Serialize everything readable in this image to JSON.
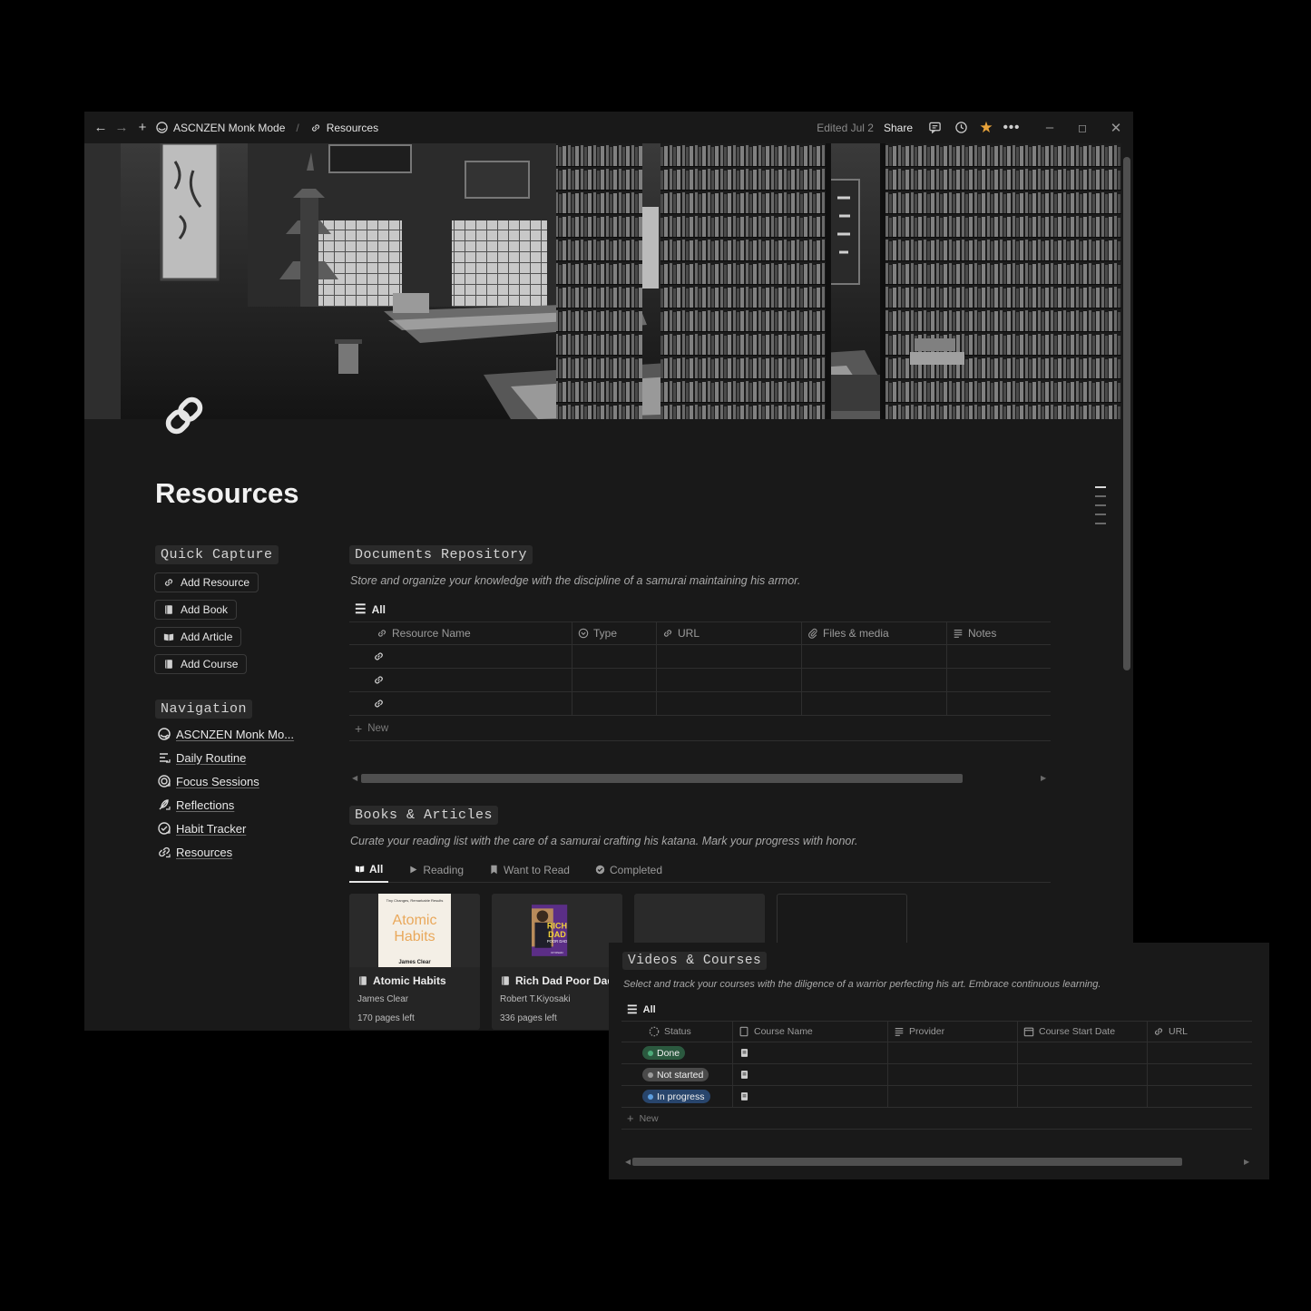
{
  "topbar": {
    "workspace": "ASCNZEN Monk Mode",
    "page": "Resources",
    "edited": "Edited Jul 2",
    "share": "Share"
  },
  "page": {
    "title": "Resources"
  },
  "quick_capture": {
    "heading": "Quick Capture",
    "buttons": [
      "Add Resource",
      "Add Book",
      "Add Article",
      "Add Course"
    ]
  },
  "navigation": {
    "heading": "Navigation",
    "links": [
      "ASCNZEN Monk Mo...",
      "Daily Routine",
      "Focus Sessions",
      "Reflections",
      "Habit Tracker",
      "Resources"
    ]
  },
  "documents": {
    "heading": "Documents Repository",
    "description": "Store and organize your knowledge with the discipline of a samurai maintaining his armor.",
    "view": "All",
    "columns": [
      "Resource Name",
      "Type",
      "URL",
      "Files & media",
      "Notes"
    ],
    "new_label": "New"
  },
  "books": {
    "heading": "Books & Articles",
    "description": "Curate your reading list with the care of a samurai crafting his katana. Mark your progress with honor.",
    "tabs": [
      "All",
      "Reading",
      "Want to Read",
      "Completed"
    ],
    "cards": [
      {
        "title": "Atomic Habits",
        "author": "James Clear",
        "progress": "170 pages left",
        "cover_tagline": "Tiny Changes, Remarkable Results",
        "cover_title_1": "Atomic",
        "cover_title_2": "Habits",
        "cover_author": "James Clear"
      },
      {
        "title": "Rich Dad Poor Dad",
        "author": "Robert T.Kiyosaki",
        "progress": "336 pages left",
        "cover_title_1": "RICH",
        "cover_title_2": "DAD",
        "cover_title_3": "POOR DAD",
        "cover_author": "KIYOSAKI"
      }
    ]
  },
  "courses": {
    "heading": "Videos & Courses",
    "description": "Select and track your courses with the diligence of a warrior perfecting his art. Embrace continuous learning.",
    "view": "All",
    "columns": [
      "Status",
      "Course Name",
      "Provider",
      "Course Start Date",
      "URL"
    ],
    "rows": [
      {
        "status": "Done",
        "color": "#2b593f",
        "dot": "#4dab7a"
      },
      {
        "status": "Not started",
        "color": "#4a4a4a",
        "dot": "#9b9b9b"
      },
      {
        "status": "In progress",
        "color": "#28456c",
        "dot": "#5e9fe0"
      }
    ],
    "new_label": "New"
  }
}
